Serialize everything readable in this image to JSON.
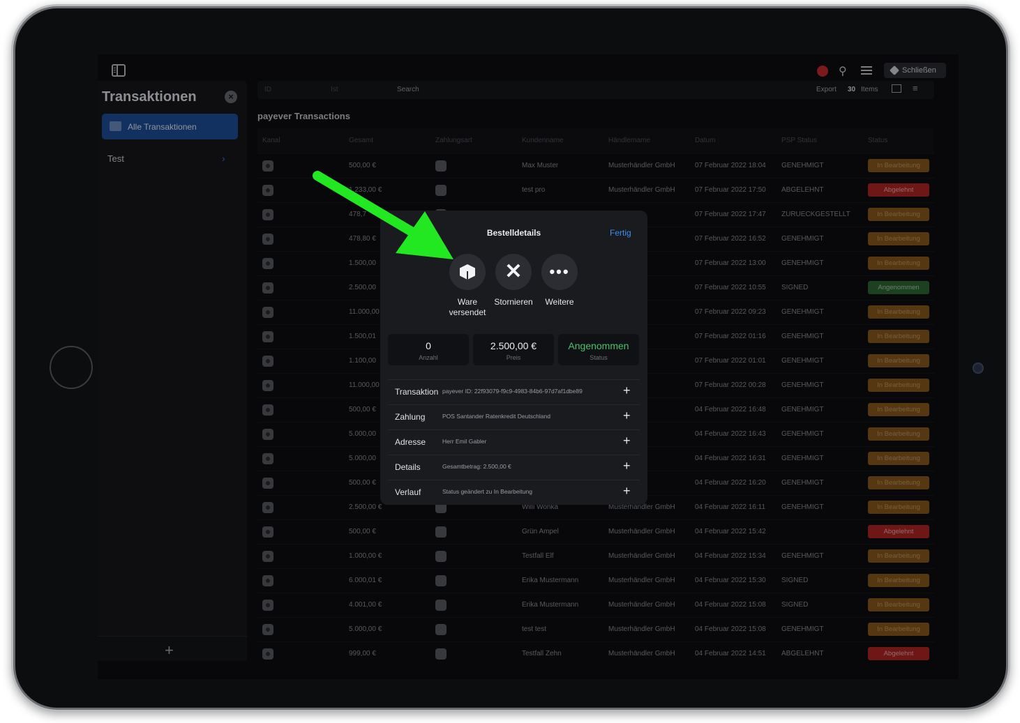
{
  "topbar": {
    "close_label": "Schließen"
  },
  "sidebar": {
    "title": "Transaktionen",
    "active_item": "Alle Transaktionen",
    "items": [
      {
        "label": "Test"
      }
    ]
  },
  "searchbar": {
    "field_id": "ID",
    "field_ist": "Ist",
    "search_placeholder": "Search",
    "export_label": "Export",
    "items_count": "30",
    "items_label": "Items"
  },
  "main": {
    "title": "payever Transactions"
  },
  "table": {
    "headers": [
      "Kanal",
      "Gesamt",
      "Zahlungsart",
      "Kundenname",
      "Händlername",
      "Datum",
      "PSP Status",
      "Status"
    ],
    "rows": [
      {
        "total": "500,00 €",
        "customer": "Max Muster",
        "merchant": "Musterhändler GmbH",
        "date": "07 Februar 2022 18:04",
        "psp": "GENEHMIGT",
        "status": "In Bearbeitung",
        "kind": "proc"
      },
      {
        "total": "1.233,00 €",
        "customer": "test pro",
        "merchant": "Musterhändler GmbH",
        "date": "07 Februar 2022 17:50",
        "psp": "ABGELEHNT",
        "status": "Abgelehnt",
        "kind": "rej"
      },
      {
        "total": "478,7",
        "customer": "",
        "merchant": "ler GmbH",
        "date": "07 Februar 2022 17:47",
        "psp": "ZURUECKGESTELLT",
        "status": "In Bearbeitung",
        "kind": "proc"
      },
      {
        "total": "478,80 €",
        "customer": "",
        "merchant": "ler GmbH",
        "date": "07 Februar 2022 16:52",
        "psp": "GENEHMIGT",
        "status": "In Bearbeitung",
        "kind": "proc"
      },
      {
        "total": "1.500,00",
        "customer": "",
        "merchant": "ler GmbH",
        "date": "07 Februar 2022 13:00",
        "psp": "GENEHMIGT",
        "status": "In Bearbeitung",
        "kind": "proc"
      },
      {
        "total": "2.500,00",
        "customer": "",
        "merchant": "ler GmbH",
        "date": "07 Februar 2022 10:55",
        "psp": "SIGNED",
        "status": "Angenommen",
        "kind": "acc"
      },
      {
        "total": "11.000,00",
        "customer": "",
        "merchant": "ler GmbH",
        "date": "07 Februar 2022 09:23",
        "psp": "GENEHMIGT",
        "status": "In Bearbeitung",
        "kind": "proc"
      },
      {
        "total": "1.500,01",
        "customer": "",
        "merchant": "ler GmbH",
        "date": "07 Februar 2022 01:16",
        "psp": "GENEHMIGT",
        "status": "In Bearbeitung",
        "kind": "proc"
      },
      {
        "total": "1.100,00",
        "customer": "",
        "merchant": "ler GmbH",
        "date": "07 Februar 2022 01:01",
        "psp": "GENEHMIGT",
        "status": "In Bearbeitung",
        "kind": "proc"
      },
      {
        "total": "11.000,00",
        "customer": "",
        "merchant": "ler GmbH",
        "date": "07 Februar 2022 00:28",
        "psp": "GENEHMIGT",
        "status": "In Bearbeitung",
        "kind": "proc"
      },
      {
        "total": "500,00 €",
        "customer": "",
        "merchant": "ler GmbH",
        "date": "04 Februar 2022 16:48",
        "psp": "GENEHMIGT",
        "status": "In Bearbeitung",
        "kind": "proc"
      },
      {
        "total": "5.000,00",
        "customer": "",
        "merchant": "ler GmbH",
        "date": "04 Februar 2022 16:43",
        "psp": "GENEHMIGT",
        "status": "In Bearbeitung",
        "kind": "proc"
      },
      {
        "total": "5.000,00",
        "customer": "",
        "merchant": "ler GmbH",
        "date": "04 Februar 2022 16:31",
        "psp": "GENEHMIGT",
        "status": "In Bearbeitung",
        "kind": "proc"
      },
      {
        "total": "500,00 €",
        "customer": "",
        "merchant": "ler GmbH",
        "date": "04 Februar 2022 16:20",
        "psp": "GENEHMIGT",
        "status": "In Bearbeitung",
        "kind": "proc"
      },
      {
        "total": "2.500,00 €",
        "customer": "Willi Wonka",
        "merchant": "Musterhändler GmbH",
        "date": "04 Februar 2022 16:11",
        "psp": "GENEHMIGT",
        "status": "In Bearbeitung",
        "kind": "proc"
      },
      {
        "total": "500,00 €",
        "customer": "Grün Ampel",
        "merchant": "Musterhändler GmbH",
        "date": "04 Februar 2022 15:42",
        "psp": "",
        "status": "Abgelehnt",
        "kind": "rej"
      },
      {
        "total": "1.000,00 €",
        "customer": "Testfall Elf",
        "merchant": "Musterhändler GmbH",
        "date": "04 Februar 2022 15:34",
        "psp": "GENEHMIGT",
        "status": "In Bearbeitung",
        "kind": "proc"
      },
      {
        "total": "6.000,01 €",
        "customer": "Erika Mustermann",
        "merchant": "Musterhändler GmbH",
        "date": "04 Februar 2022 15:30",
        "psp": "SIGNED",
        "status": "In Bearbeitung",
        "kind": "proc"
      },
      {
        "total": "4.001,00 €",
        "customer": "Erika Mustermann",
        "merchant": "Musterhändler GmbH",
        "date": "04 Februar 2022 15:08",
        "psp": "SIGNED",
        "status": "In Bearbeitung",
        "kind": "proc"
      },
      {
        "total": "5.000,00 €",
        "customer": "test test",
        "merchant": "Musterhändler GmbH",
        "date": "04 Februar 2022 15:08",
        "psp": "GENEHMIGT",
        "status": "In Bearbeitung",
        "kind": "proc"
      },
      {
        "total": "999,00 €",
        "customer": "Testfall Zehn",
        "merchant": "Musterhändler GmbH",
        "date": "04 Februar 2022 14:51",
        "psp": "ABGELEHNT",
        "status": "Abgelehnt",
        "kind": "rej"
      }
    ]
  },
  "modal": {
    "title": "Bestelldetails",
    "done_label": "Fertig",
    "actions": [
      {
        "label_line1": "Ware",
        "label_line2": "versendet",
        "icon": "box-icon"
      },
      {
        "label_line1": "Stornieren",
        "label_line2": "",
        "icon": "close-icon"
      },
      {
        "label_line1": "Weitere",
        "label_line2": "",
        "icon": "more-icon"
      }
    ],
    "stats": [
      {
        "value": "0",
        "label": "Anzahl"
      },
      {
        "value": "2.500,00 €",
        "label": "Preis"
      },
      {
        "value": "Angenommen",
        "label": "Status"
      }
    ],
    "details": [
      {
        "key": "Transaktion",
        "value": "payever ID: 22f93079-f9c9-4983-84b6-97d7af1dbe89"
      },
      {
        "key": "Zahlung",
        "value": "POS Santander Ratenkredit Deutschland"
      },
      {
        "key": "Adresse",
        "value": "Herr Emil Gabler"
      },
      {
        "key": "Details",
        "value": "Gesamtbetrag: 2.500,00 €"
      },
      {
        "key": "Verlauf",
        "value": "Status geändert zu In Bearbeitung"
      }
    ]
  },
  "colors": {
    "accent_blue": "#1d4f9c",
    "status_processing": "#8a5a1c",
    "status_rejected": "#b32424",
    "status_accepted": "#2f6a35",
    "annotation_arrow": "#22e822"
  }
}
